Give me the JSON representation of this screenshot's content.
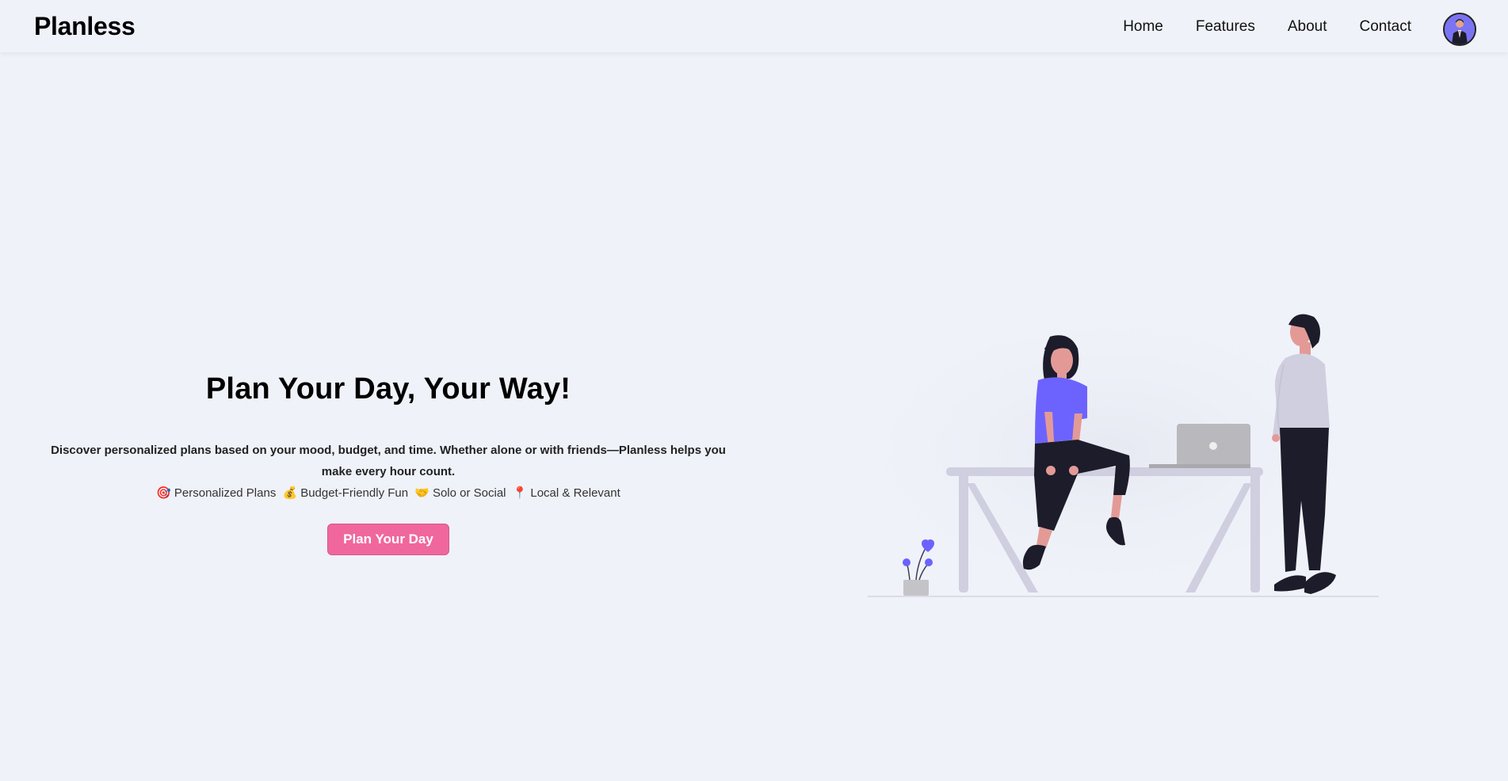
{
  "navbar": {
    "brand": "Planless",
    "links": [
      "Home",
      "Features",
      "About",
      "Contact"
    ]
  },
  "hero": {
    "title": "Plan Your Day, Your Way!",
    "description": "Discover personalized plans based on your mood, budget, and time. Whether alone or with friends—Planless helps you make every hour count.",
    "features": [
      {
        "icon": "🎯",
        "icon_name": "target-icon",
        "label": "Personalized Plans"
      },
      {
        "icon": "💰",
        "icon_name": "money-bag-icon",
        "label": "Budget-Friendly Fun"
      },
      {
        "icon": "🤝",
        "icon_name": "handshake-icon",
        "label": "Solo or Social"
      },
      {
        "icon": "📍",
        "icon_name": "pin-icon",
        "label": "Local & Relevant"
      }
    ],
    "cta_label": "Plan Your Day"
  },
  "colors": {
    "background": "#eff2f9",
    "accent": "#f0679d",
    "illustration_purple": "#6c63ff",
    "illustration_gray": "#cfcfe0"
  }
}
